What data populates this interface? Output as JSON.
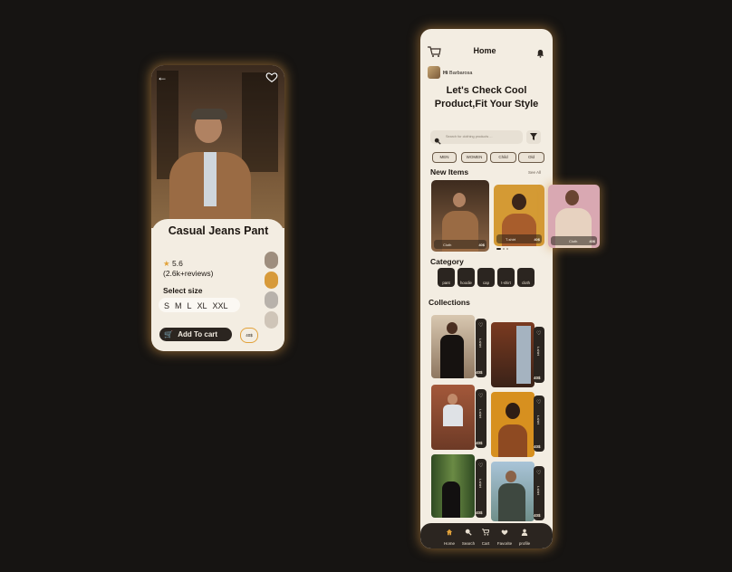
{
  "detail": {
    "product_name": "Casual Jeans Pant",
    "rating": "5.6",
    "reviews": "(2.6k+reviews)",
    "select_size_label": "Select size",
    "sizes": [
      "S",
      "M",
      "L",
      "XL",
      "XXL"
    ],
    "add_to_cart_label": "Add To cart",
    "price": "40$",
    "swatch_colors": [
      "#9e8e7e",
      "#d79a3a",
      "#b8b2ab",
      "#cfc5b8"
    ]
  },
  "home": {
    "title": "Home",
    "greeting_prefix": "Hi",
    "greeting_name": "Barbarosa",
    "headline": "Let's Check Cool Product,Fit Your Style",
    "search_placeholder": "Search for clothing products ...",
    "filters": [
      "MEN",
      "WOMEN",
      "Child",
      "Old"
    ],
    "new_items_title": "New Items",
    "see_all_label": "See All",
    "new_items": [
      {
        "label": "Cloth",
        "price": "40$"
      },
      {
        "label": "T-shirt",
        "price": "40$"
      },
      {
        "label": "Cloth",
        "price": "40$"
      }
    ],
    "category_title": "Category",
    "categories": [
      "pant",
      "hoodie",
      "cap",
      "t-shirt",
      "cloth"
    ],
    "collections_title": "Collections",
    "collections": [
      {
        "label": "t-shirt",
        "price": "40$"
      },
      {
        "label": "t-shirt",
        "price": "40$"
      },
      {
        "label": "t-shirt",
        "price": "40$"
      },
      {
        "label": "t-shirt",
        "price": "40$"
      },
      {
        "label": "t-shirt",
        "price": "40$"
      },
      {
        "label": "t-shirt",
        "price": "40$"
      }
    ],
    "tabs": [
      "Home",
      "Search",
      "Cart",
      "Favorite",
      "profile"
    ]
  },
  "colors": {
    "page_background": "#161412",
    "card_background": "#f3ede2",
    "dark_accent": "#2b2520",
    "glow": "#d6964a"
  }
}
